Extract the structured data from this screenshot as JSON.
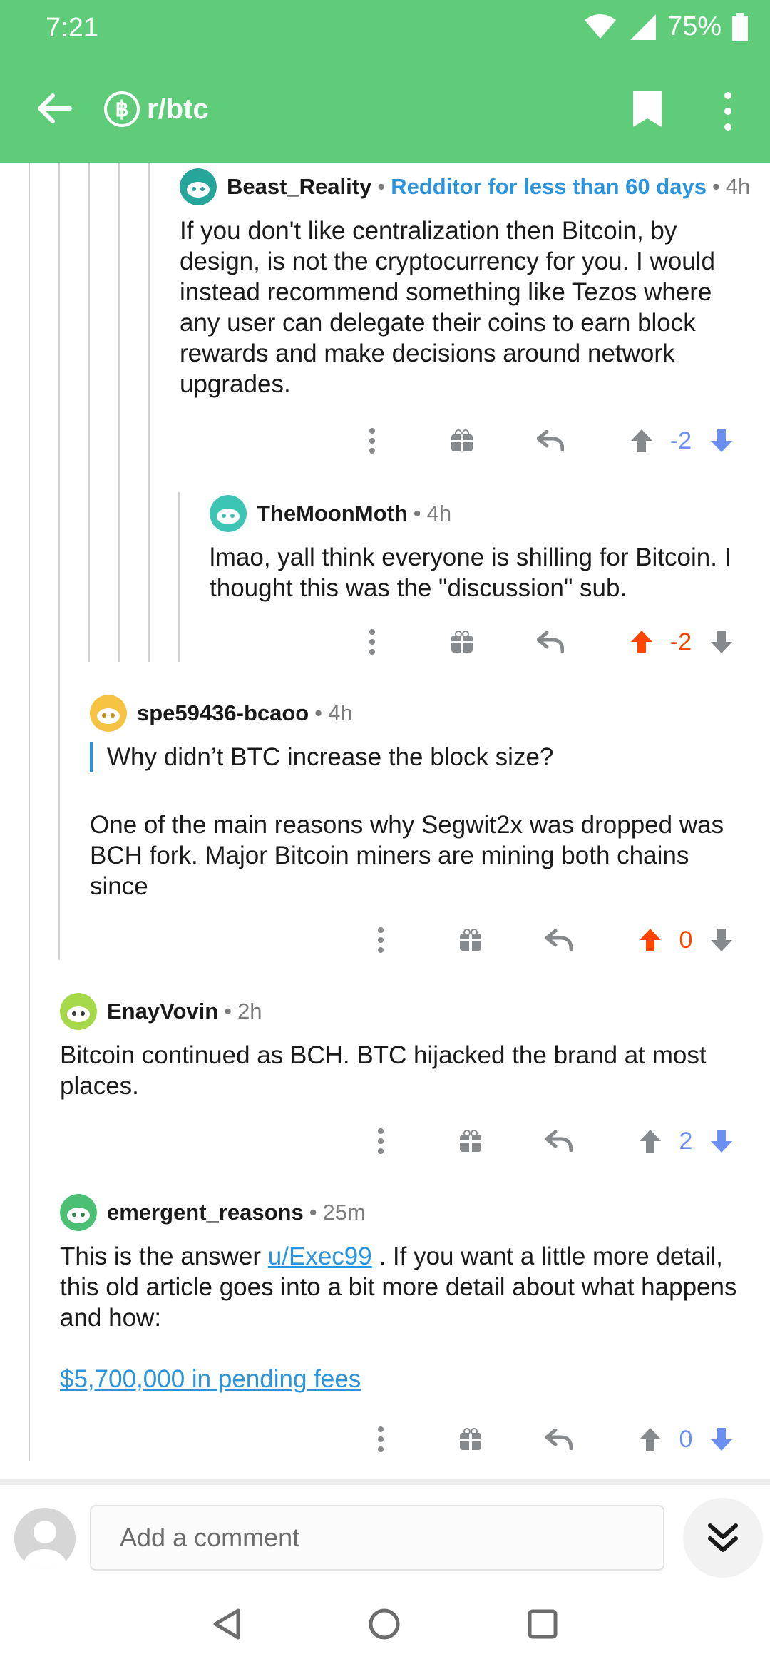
{
  "status": {
    "time": "7:21",
    "battery": "75%"
  },
  "header": {
    "subreddit": "r/btc",
    "sub_icon_glyph": "฿"
  },
  "comments": [
    {
      "author": "Beast_Reality",
      "flair": "Redditor for less than 60 days",
      "time": "4h",
      "body": "If you don't like centralization then Bitcoin, by design, is not the cryptocurrency for you. I would instead recommend something like Tezos where any user can delegate their coins to earn block rewards and make decisions around network upgrades.",
      "score": "-2",
      "vote": "down"
    },
    {
      "author": "TheMoonMoth",
      "time": "4h",
      "body": "lmao, yall think everyone is shilling for Bitcoin. I thought this was the \"discussion\" sub.",
      "score": "-2",
      "vote": "up"
    },
    {
      "author": "spe59436-bcaoo",
      "time": "4h",
      "quote": "Why didn’t BTC increase the block size?",
      "body": "One of the main reasons why Segwit2x was dropped was BCH fork. Major Bitcoin miners are mining both chains since",
      "score": "0",
      "vote": "up"
    },
    {
      "author": "EnayVovin",
      "time": "2h",
      "body": "Bitcoin continued as BCH. BTC hijacked the brand at most places.",
      "score": "2",
      "vote": "down"
    },
    {
      "author": "emergent_reasons",
      "time": "25m",
      "body_prefix": "This is the answer ",
      "mention": "u/Exec99",
      "body_suffix": " . If you want a little more detail, this old article goes into a bit more detail about what happens and how:",
      "link": "$5,700,000 in pending fees",
      "score": "0",
      "vote": "down"
    }
  ],
  "composer": {
    "placeholder": "Add a comment"
  },
  "colors": {
    "appbar": "#5fcc79",
    "upvote": "#ff4500",
    "downvote": "#6a8ff0",
    "flair": "#2a95de"
  },
  "icons": [
    "back-arrow-icon",
    "bitcoin-icon",
    "bookmark-icon",
    "more-vertical-icon",
    "gift-icon",
    "reply-icon",
    "upvote-icon",
    "downvote-icon",
    "double-chevron-down-icon",
    "nav-back-icon",
    "nav-home-icon",
    "nav-recents-icon"
  ]
}
